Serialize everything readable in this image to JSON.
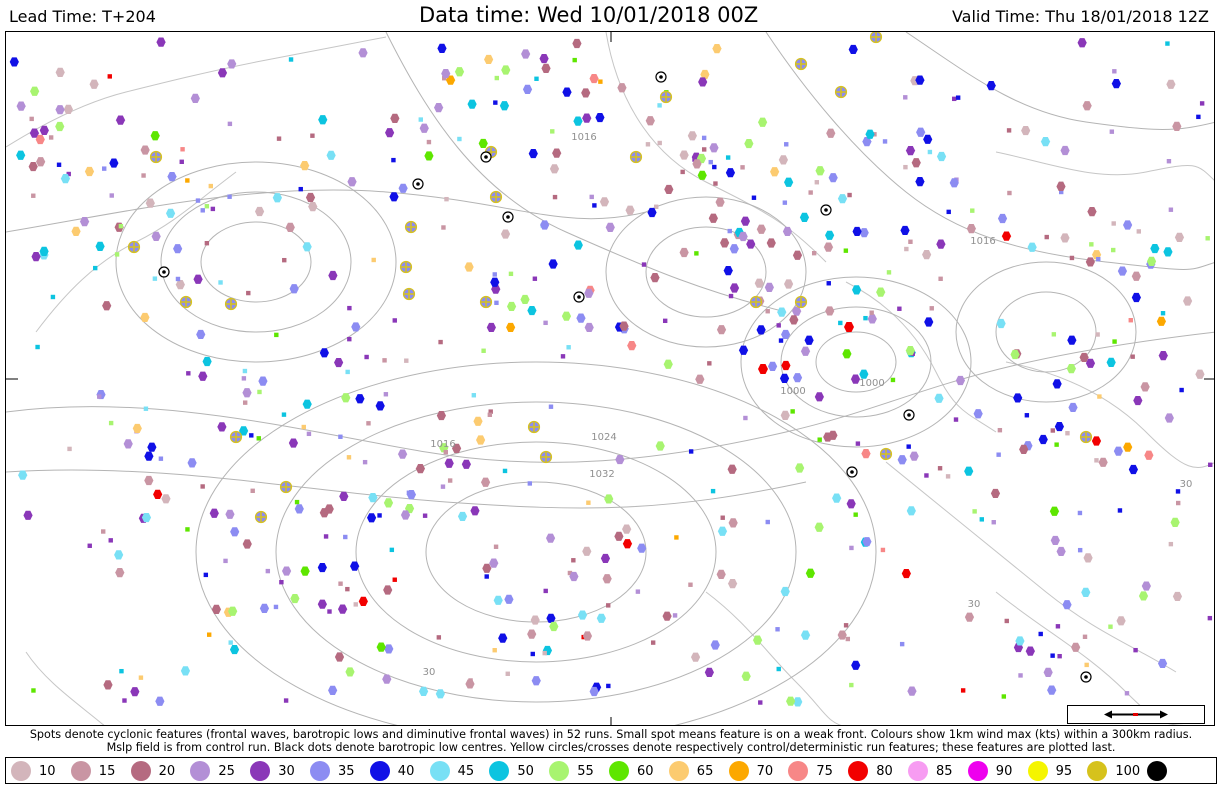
{
  "header": {
    "lead_time": "Lead Time: T+204",
    "data_time": "Data time:  Wed 10/01/2018 00Z",
    "valid_time": "Valid Time: Thu 18/01/2018 12Z"
  },
  "map": {
    "isobar_labels": [
      "1024",
      "1032",
      "1016",
      "1016",
      "1000",
      "1016",
      "30",
      "30",
      "30",
      "1000"
    ],
    "colors": {
      "isobar": "#b4b4b4",
      "coast": "#c6c6c6",
      "scale_arrow": "#000000",
      "scale_marker": "#e00000"
    }
  },
  "footer": {
    "line1": "Spots denote cyclonic features (frontal waves, barotropic lows and diminutive frontal waves) in 52 runs. Small spot means feature is on a weak front. Colours show 1km wind max (kts) within a 300km radius.",
    "line2": "Mslp field is from control run. Black dots denote barotropic low centres. Yellow circles/crosses denote respectively control/deterministic run features; these features are plotted last."
  },
  "legend": [
    {
      "label": "10",
      "color": "#d3b5bb"
    },
    {
      "label": "15",
      "color": "#c995a3"
    },
    {
      "label": "20",
      "color": "#b56a80"
    },
    {
      "label": "25",
      "color": "#b38fd6"
    },
    {
      "label": "30",
      "color": "#8a37b8"
    },
    {
      "label": "35",
      "color": "#8c8cf2"
    },
    {
      "label": "40",
      "color": "#1010e6"
    },
    {
      "label": "45",
      "color": "#78e0f5"
    },
    {
      "label": "50",
      "color": "#0cc4e0"
    },
    {
      "label": "55",
      "color": "#a8f470"
    },
    {
      "label": "60",
      "color": "#5ee600"
    },
    {
      "label": "65",
      "color": "#fccb70"
    },
    {
      "label": "70",
      "color": "#fca800"
    },
    {
      "label": "75",
      "color": "#f78787"
    },
    {
      "label": "80",
      "color": "#f20000"
    },
    {
      "label": "85",
      "color": "#f79cf2"
    },
    {
      "label": "90",
      "color": "#ee00ee"
    },
    {
      "label": "95",
      "color": "#f5f500"
    },
    {
      "label": "100",
      "color": "#d6c21c"
    },
    {
      "label": "",
      "color": "#000000"
    }
  ]
}
